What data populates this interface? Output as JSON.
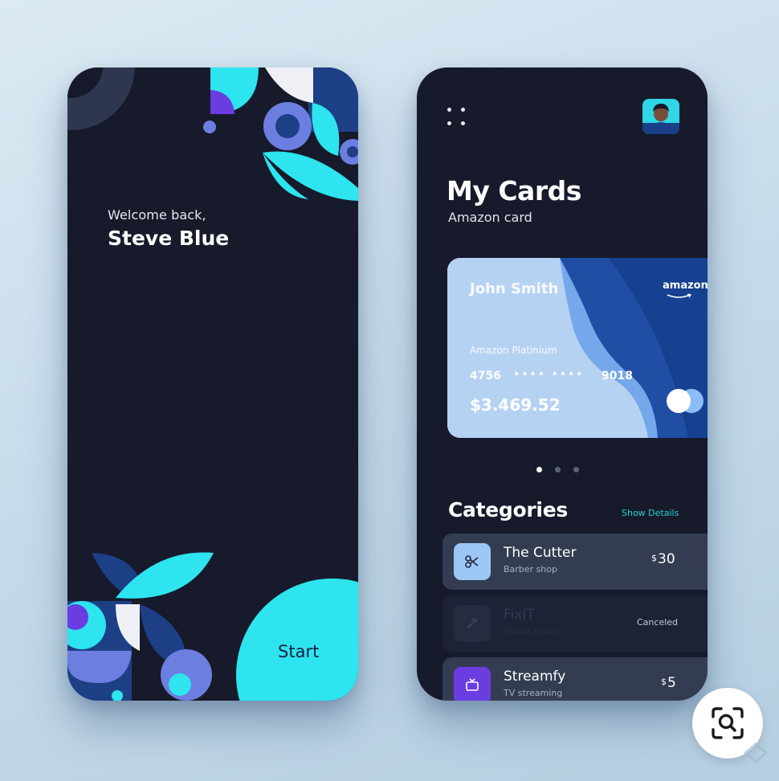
{
  "welcome_screen": {
    "greeting": "Welcome back,",
    "user_name": "Steve Blue",
    "start_label": "Start"
  },
  "cards_screen": {
    "title": "My Cards",
    "subtitle": "Amazon card",
    "card": {
      "holder": "John Smith",
      "brand": "amazon",
      "type": "Amazon Platinium",
      "number_start": "4756",
      "number_mask": "•••• ••••",
      "number_end": "9018",
      "balance": "$3.469.52"
    },
    "pager": {
      "count": 3,
      "active": 0
    },
    "categories_title": "Categories",
    "show_details": "Show Details",
    "categories": [
      {
        "name": "The Cutter",
        "sub": "Barber shop",
        "currency": "$",
        "amount": "30",
        "icon": "scissors-icon"
      },
      {
        "name": "FixIT",
        "sub": "Phone repair",
        "status": "Canceled",
        "icon": "hammer-icon"
      },
      {
        "name": "Streamfy",
        "sub": "TV streaming",
        "currency": "$",
        "amount": "5",
        "icon": "tv-icon"
      }
    ]
  },
  "colors": {
    "background": "#161a2b",
    "cyan": "#2de4ef",
    "blue": "#1b3f87",
    "periwinkle": "#6c7fe0",
    "purple": "#6b3ee0",
    "accent_text": "#26d3d3"
  }
}
